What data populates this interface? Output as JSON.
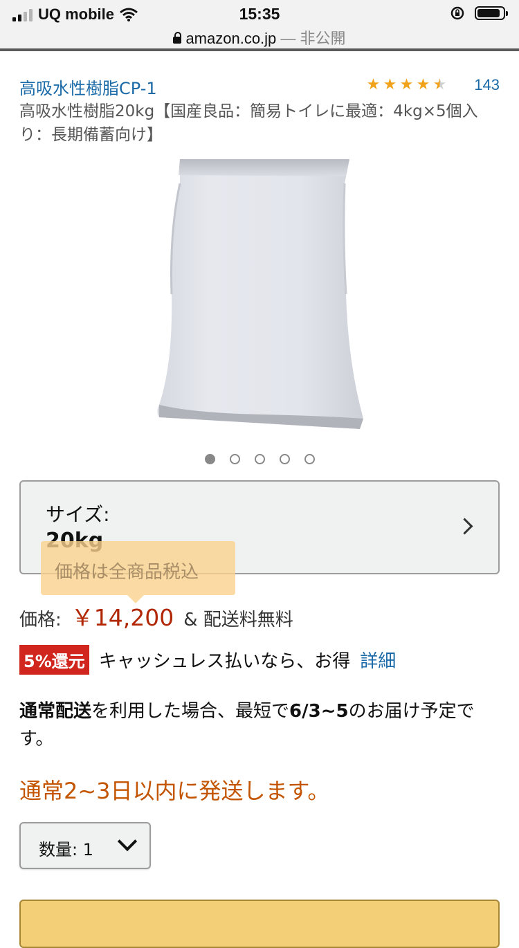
{
  "status_bar": {
    "carrier": "UQ mobile",
    "time": "15:35"
  },
  "url_bar": {
    "domain": "amazon.co.jp",
    "privacy": "— 非公開"
  },
  "product": {
    "brand": "高吸水性樹脂CP-1",
    "rating_stars": "★★★★☆",
    "rating_value": 4.5,
    "review_count": "143",
    "title": "高吸水性樹脂20kg【国産良品：簡易トイレに最適：4kg×5個入り：長期備蓄向け】",
    "image_count": 5,
    "active_image_index": 0
  },
  "size": {
    "label": "サイズ:",
    "value": "20kg"
  },
  "tooltip": {
    "text": "価格は全商品税込"
  },
  "price": {
    "label": "価格:",
    "value": "￥14,200",
    "suffix": "& 配送料無料"
  },
  "cashless": {
    "badge": "5%還元",
    "text": "キャッシュレス払いなら、お得",
    "link": "詳細"
  },
  "delivery": {
    "bold1": "通常配送",
    "text1": "を利用した場合、最短で",
    "date": "6/3~5",
    "text2": "のお届け予定です。"
  },
  "shipping_note": "通常2~3日以内に発送します。",
  "quantity": {
    "label": "数量: 1"
  },
  "colors": {
    "link": "#1a6aa8",
    "price": "#b12704",
    "ship": "#c45500",
    "badge": "#d0261d",
    "star": "#f0a21a"
  }
}
